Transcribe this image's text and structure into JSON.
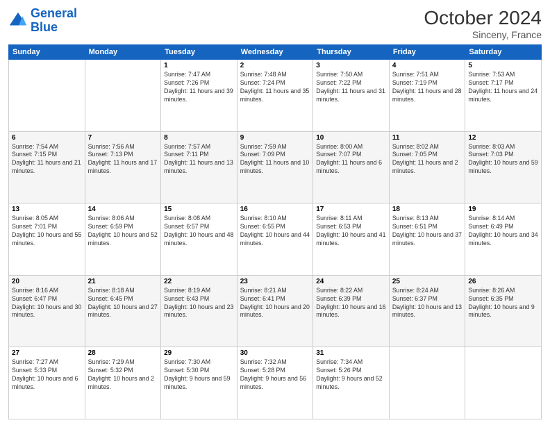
{
  "header": {
    "logo_line1": "General",
    "logo_line2": "Blue",
    "month_title": "October 2024",
    "subtitle": "Sinceny, France"
  },
  "days_of_week": [
    "Sunday",
    "Monday",
    "Tuesday",
    "Wednesday",
    "Thursday",
    "Friday",
    "Saturday"
  ],
  "weeks": [
    [
      {
        "day": "",
        "sunrise": "",
        "sunset": "",
        "daylight": ""
      },
      {
        "day": "",
        "sunrise": "",
        "sunset": "",
        "daylight": ""
      },
      {
        "day": "1",
        "sunrise": "Sunrise: 7:47 AM",
        "sunset": "Sunset: 7:26 PM",
        "daylight": "Daylight: 11 hours and 39 minutes."
      },
      {
        "day": "2",
        "sunrise": "Sunrise: 7:48 AM",
        "sunset": "Sunset: 7:24 PM",
        "daylight": "Daylight: 11 hours and 35 minutes."
      },
      {
        "day": "3",
        "sunrise": "Sunrise: 7:50 AM",
        "sunset": "Sunset: 7:22 PM",
        "daylight": "Daylight: 11 hours and 31 minutes."
      },
      {
        "day": "4",
        "sunrise": "Sunrise: 7:51 AM",
        "sunset": "Sunset: 7:19 PM",
        "daylight": "Daylight: 11 hours and 28 minutes."
      },
      {
        "day": "5",
        "sunrise": "Sunrise: 7:53 AM",
        "sunset": "Sunset: 7:17 PM",
        "daylight": "Daylight: 11 hours and 24 minutes."
      }
    ],
    [
      {
        "day": "6",
        "sunrise": "Sunrise: 7:54 AM",
        "sunset": "Sunset: 7:15 PM",
        "daylight": "Daylight: 11 hours and 21 minutes."
      },
      {
        "day": "7",
        "sunrise": "Sunrise: 7:56 AM",
        "sunset": "Sunset: 7:13 PM",
        "daylight": "Daylight: 11 hours and 17 minutes."
      },
      {
        "day": "8",
        "sunrise": "Sunrise: 7:57 AM",
        "sunset": "Sunset: 7:11 PM",
        "daylight": "Daylight: 11 hours and 13 minutes."
      },
      {
        "day": "9",
        "sunrise": "Sunrise: 7:59 AM",
        "sunset": "Sunset: 7:09 PM",
        "daylight": "Daylight: 11 hours and 10 minutes."
      },
      {
        "day": "10",
        "sunrise": "Sunrise: 8:00 AM",
        "sunset": "Sunset: 7:07 PM",
        "daylight": "Daylight: 11 hours and 6 minutes."
      },
      {
        "day": "11",
        "sunrise": "Sunrise: 8:02 AM",
        "sunset": "Sunset: 7:05 PM",
        "daylight": "Daylight: 11 hours and 2 minutes."
      },
      {
        "day": "12",
        "sunrise": "Sunrise: 8:03 AM",
        "sunset": "Sunset: 7:03 PM",
        "daylight": "Daylight: 10 hours and 59 minutes."
      }
    ],
    [
      {
        "day": "13",
        "sunrise": "Sunrise: 8:05 AM",
        "sunset": "Sunset: 7:01 PM",
        "daylight": "Daylight: 10 hours and 55 minutes."
      },
      {
        "day": "14",
        "sunrise": "Sunrise: 8:06 AM",
        "sunset": "Sunset: 6:59 PM",
        "daylight": "Daylight: 10 hours and 52 minutes."
      },
      {
        "day": "15",
        "sunrise": "Sunrise: 8:08 AM",
        "sunset": "Sunset: 6:57 PM",
        "daylight": "Daylight: 10 hours and 48 minutes."
      },
      {
        "day": "16",
        "sunrise": "Sunrise: 8:10 AM",
        "sunset": "Sunset: 6:55 PM",
        "daylight": "Daylight: 10 hours and 44 minutes."
      },
      {
        "day": "17",
        "sunrise": "Sunrise: 8:11 AM",
        "sunset": "Sunset: 6:53 PM",
        "daylight": "Daylight: 10 hours and 41 minutes."
      },
      {
        "day": "18",
        "sunrise": "Sunrise: 8:13 AM",
        "sunset": "Sunset: 6:51 PM",
        "daylight": "Daylight: 10 hours and 37 minutes."
      },
      {
        "day": "19",
        "sunrise": "Sunrise: 8:14 AM",
        "sunset": "Sunset: 6:49 PM",
        "daylight": "Daylight: 10 hours and 34 minutes."
      }
    ],
    [
      {
        "day": "20",
        "sunrise": "Sunrise: 8:16 AM",
        "sunset": "Sunset: 6:47 PM",
        "daylight": "Daylight: 10 hours and 30 minutes."
      },
      {
        "day": "21",
        "sunrise": "Sunrise: 8:18 AM",
        "sunset": "Sunset: 6:45 PM",
        "daylight": "Daylight: 10 hours and 27 minutes."
      },
      {
        "day": "22",
        "sunrise": "Sunrise: 8:19 AM",
        "sunset": "Sunset: 6:43 PM",
        "daylight": "Daylight: 10 hours and 23 minutes."
      },
      {
        "day": "23",
        "sunrise": "Sunrise: 8:21 AM",
        "sunset": "Sunset: 6:41 PM",
        "daylight": "Daylight: 10 hours and 20 minutes."
      },
      {
        "day": "24",
        "sunrise": "Sunrise: 8:22 AM",
        "sunset": "Sunset: 6:39 PM",
        "daylight": "Daylight: 10 hours and 16 minutes."
      },
      {
        "day": "25",
        "sunrise": "Sunrise: 8:24 AM",
        "sunset": "Sunset: 6:37 PM",
        "daylight": "Daylight: 10 hours and 13 minutes."
      },
      {
        "day": "26",
        "sunrise": "Sunrise: 8:26 AM",
        "sunset": "Sunset: 6:35 PM",
        "daylight": "Daylight: 10 hours and 9 minutes."
      }
    ],
    [
      {
        "day": "27",
        "sunrise": "Sunrise: 7:27 AM",
        "sunset": "Sunset: 5:33 PM",
        "daylight": "Daylight: 10 hours and 6 minutes."
      },
      {
        "day": "28",
        "sunrise": "Sunrise: 7:29 AM",
        "sunset": "Sunset: 5:32 PM",
        "daylight": "Daylight: 10 hours and 2 minutes."
      },
      {
        "day": "29",
        "sunrise": "Sunrise: 7:30 AM",
        "sunset": "Sunset: 5:30 PM",
        "daylight": "Daylight: 9 hours and 59 minutes."
      },
      {
        "day": "30",
        "sunrise": "Sunrise: 7:32 AM",
        "sunset": "Sunset: 5:28 PM",
        "daylight": "Daylight: 9 hours and 56 minutes."
      },
      {
        "day": "31",
        "sunrise": "Sunrise: 7:34 AM",
        "sunset": "Sunset: 5:26 PM",
        "daylight": "Daylight: 9 hours and 52 minutes."
      },
      {
        "day": "",
        "sunrise": "",
        "sunset": "",
        "daylight": ""
      },
      {
        "day": "",
        "sunrise": "",
        "sunset": "",
        "daylight": ""
      }
    ]
  ]
}
